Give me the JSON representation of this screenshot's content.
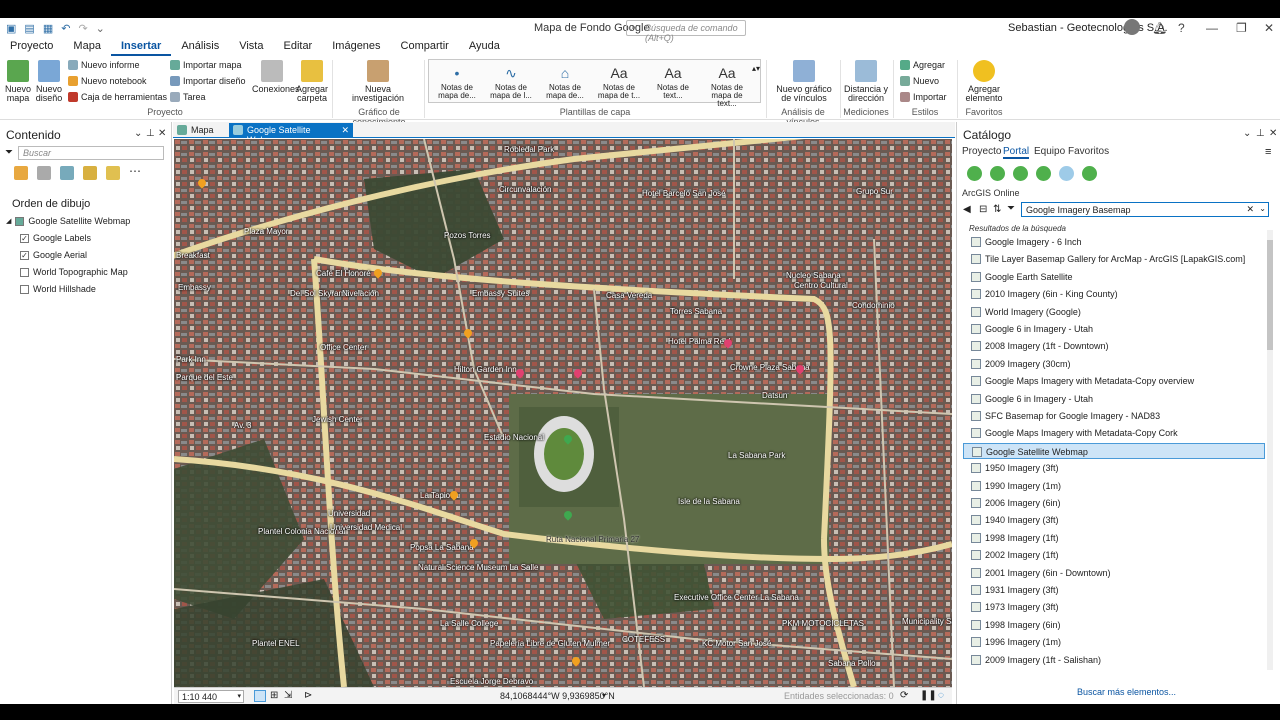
{
  "app": {
    "title": "Mapa de Fondo Google",
    "command_search_placeholder": "Búsqueda de comando (Alt+Q)",
    "user": "Sebastian - Geotecnologías S.A."
  },
  "menu": [
    "Proyecto",
    "Mapa",
    "Insertar",
    "Análisis",
    "Vista",
    "Editar",
    "Imágenes",
    "Compartir",
    "Ayuda"
  ],
  "ribbon": {
    "nuevo_mapa": "Nuevo mapa",
    "nuevo_diseno": "Nuevo diseño",
    "nuevo_informe": "Nuevo informe",
    "nuevo_notebook": "Nuevo notebook",
    "caja_herramientas": "Caja de herramientas",
    "importar_mapa": "Importar mapa",
    "importar_diseno": "Importar diseño",
    "tarea": "Tarea",
    "conexiones": "Conexiones",
    "agregar_carpeta": "Agregar carpeta",
    "nueva_investigacion": "Nueva investigación",
    "gallery": [
      "Notas de mapa de...",
      "Notas de mapa de l...",
      "Notas de mapa de...",
      "Notas de mapa de t...",
      "Notas de text...",
      "Notas de mapa de text..."
    ],
    "gallery_glyphs": [
      "•",
      "∿",
      "⌂",
      "Aa",
      "Aa",
      "Aa"
    ],
    "nuevo_grafico": "Nuevo gráfico de vínculos",
    "distancia": "Distancia y dirección",
    "agregar": "Agregar",
    "nuevo": "Nuevo",
    "importar": "Importar",
    "agregar_elemento": "Agregar elemento",
    "groups": {
      "proyecto": "Proyecto",
      "grafico": "Gráfico de conocimiento",
      "plantillas": "Plantillas de capa",
      "analisis": "Análisis de vínculos",
      "mediciones": "Mediciones",
      "estilos": "Estilos",
      "favoritos": "Favoritos"
    }
  },
  "contents": {
    "title": "Contenido",
    "search_placeholder": "Buscar",
    "draw_order": "Orden de dibujo",
    "map_name": "Google Satellite Webmap",
    "layers": [
      {
        "name": "Google Labels",
        "checked": true
      },
      {
        "name": "Google Aerial",
        "checked": true
      },
      {
        "name": "World Topographic Map",
        "checked": false
      },
      {
        "name": "World Hillshade",
        "checked": false
      }
    ]
  },
  "map_tabs": [
    "Mapa",
    "Google Satellite Webmap"
  ],
  "map": {
    "labels": [
      "Robledal Park",
      "Circunvalación",
      "Hotel Barceló San José",
      "Grupo Sur",
      "Plaza Mayor",
      "Pozos Torres",
      "Breakfast",
      "Café El Honoré",
      "Embassy",
      "Del Sol Skyrama",
      "Nivelación",
      "Embassy Suites",
      "Casa Vereda",
      "Nucleo Sabana",
      "Centro Cultural",
      "Condominio",
      "Office Center",
      "Parque del Este",
      "Torres Sabana",
      "Hotel Palma Real",
      "Park Inn",
      "Hilton Garden Inn",
      "Crowne Plaza Sabana",
      "Datsun",
      "Av. 3",
      "Jewish Center",
      "Estadio Nacional",
      "La Sabana Park",
      "Universidad",
      "Isle de la Sabana",
      "La Tapioca",
      "Plantel Colonia Nacional",
      "Popsa La Sabana",
      "Ruta Nacional Primaria 27",
      "Natural Science Museum La Salle",
      "Executive Office Center La Sabana",
      "La Salle College",
      "PKM MOTOCICLETAS",
      "Papelería Libre de Gluten Mulmer",
      "COTEFESS",
      "KC Motor San José",
      "Escuela Jorge Debravo",
      "Plantel ENEL",
      "Universidad Medical",
      "Sabana Pollo",
      "Municipality San José"
    ],
    "scale": "1:10 440",
    "coords": "84,1068444°W 9,9369850°N",
    "selected": "Entidades seleccionadas: 0"
  },
  "catalog": {
    "title": "Catálogo",
    "tabs": [
      "Proyecto",
      "Portal",
      "Equipo",
      "Favoritos"
    ],
    "source": "ArcGIS Online",
    "search_value": "Google Imagery Basemap",
    "results_title": "Resultados de la búsqueda",
    "results": [
      "Google Imagery - 6 Inch",
      "Tile Layer Basemap Gallery for ArcMap - ArcGIS [LapakGIS.com]",
      "Google Earth Satellite",
      "2010 Imagery (6in - King County)",
      "World Imagery (Google)",
      "Google 6 in Imagery - Utah",
      "2008 Imagery (1ft - Downtown)",
      "2009 Imagery (30cm)",
      "Google Maps Imagery with Metadata-Copy overview",
      "Google 6 in Imagery - Utah",
      "SFC Basemap for Google Imagery - NAD83",
      "Google Maps Imagery with Metadata-Copy Cork",
      "Google Satellite Webmap",
      "1950 Imagery (3ft)",
      "1990 Imagery (1m)",
      "2006 Imagery (6in)",
      "1940 Imagery (3ft)",
      "1998 Imagery (1ft)",
      "2002 Imagery (1ft)",
      "2001 Imagery (6in - Downtown)",
      "1931 Imagery (3ft)",
      "1973 Imagery (3ft)",
      "1998 Imagery (6in)",
      "1996 Imagery (1m)",
      "2009 Imagery (1ft - Salishan)"
    ],
    "selected_index": 12,
    "more": "Buscar más elementos..."
  },
  "colors": {
    "accent": "#0a72c4",
    "selection": "#cde4f7",
    "road": "#e8d9a0"
  }
}
